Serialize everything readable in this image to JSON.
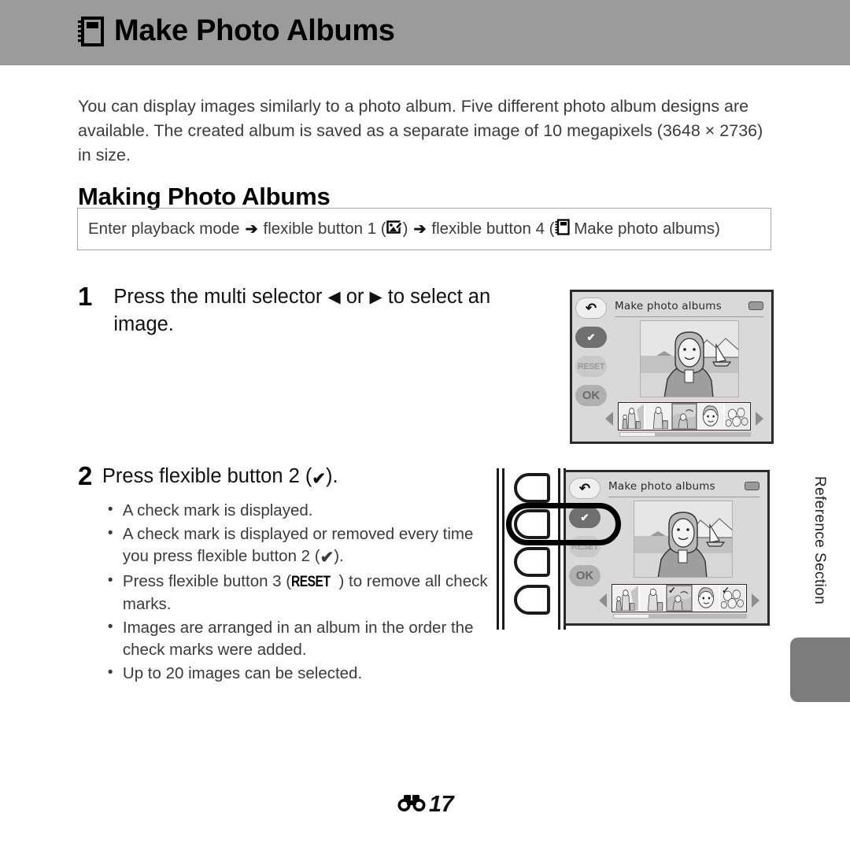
{
  "header": {
    "title": "Make Photo Albums",
    "icon": "photo-album-icon"
  },
  "intro": "You can display images similarly to a photo album. Five different photo album designs are available. The created album is saved as a separate image of 10 megapixels (3648 × 2736) in size.",
  "section_heading": "Making Photo Albums",
  "nav_path": {
    "part1": "Enter playback mode",
    "arrow1": "➔",
    "part2": "flexible button 1 (",
    "icon1": "retouch-icon",
    "part3": ")",
    "arrow2": "➔",
    "part4": "flexible button 4 (",
    "icon2": "photo-album-icon",
    "part5": "Make photo albums)"
  },
  "steps": [
    {
      "number": "1",
      "title_a": "Press the multi selector",
      "arrow_left": "◀",
      "title_b": "or",
      "arrow_right": "▶",
      "title_c": "to select an image.",
      "bullets": []
    },
    {
      "number": "2",
      "title_a": "Press flexible button 2 (",
      "check": "✔",
      "title_c": ").",
      "bullets": [
        {
          "a": "A check mark is displayed.",
          "b": "",
          "c": ""
        },
        {
          "a": "A check mark is displayed or removed every time you press flexible button 2 (",
          "b": "✔",
          "c": ")."
        },
        {
          "a": "Press flexible button 3 (",
          "b": "RESET",
          "c": ") to remove all check marks."
        },
        {
          "a": "Images are arranged in an album in the order the check marks were added.",
          "b": "",
          "c": ""
        },
        {
          "a": "Up to 20 images can be selected.",
          "b": "",
          "c": ""
        }
      ]
    }
  ],
  "screens": [
    {
      "title": "Make photo albums",
      "softkeys": {
        "back": "↶",
        "check": "✔",
        "reset": "RESET",
        "ok": "OK"
      },
      "thumbnails": [
        {
          "selected": false,
          "checked": false
        },
        {
          "selected": false,
          "checked": false
        },
        {
          "selected": true,
          "checked": false
        },
        {
          "selected": false,
          "checked": false
        },
        {
          "selected": false,
          "checked": false
        }
      ]
    },
    {
      "title": "Make photo albums",
      "softkeys": {
        "back": "↶",
        "check": "✔",
        "reset": "RESET",
        "ok": "OK"
      },
      "thumbnails": [
        {
          "selected": false,
          "checked": false
        },
        {
          "selected": false,
          "checked": false
        },
        {
          "selected": true,
          "checked": true
        },
        {
          "selected": false,
          "checked": false
        },
        {
          "selected": false,
          "checked": true
        }
      ]
    }
  ],
  "side_tab": {
    "label": "Reference Section"
  },
  "footer": {
    "page_icon": "reference-section-icon",
    "page_number": "17"
  },
  "colors": {
    "header_band": "#9b9b9b",
    "body_text": "#3b3b3b",
    "side_tab": "#7c7c7c",
    "screen_bg": "#d9d9d9"
  }
}
